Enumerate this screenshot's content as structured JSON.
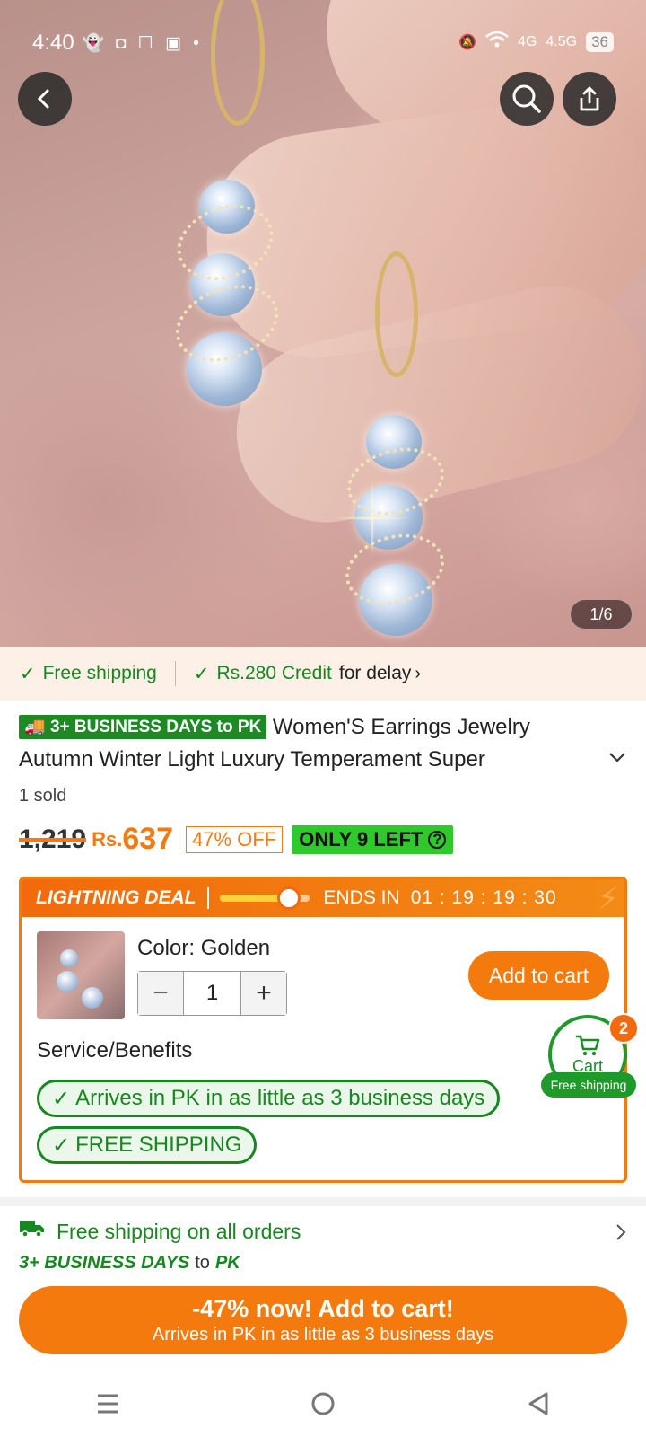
{
  "status_bar": {
    "time": "4:40",
    "battery": "36",
    "net1": "4G",
    "net2": "4.5G"
  },
  "gallery": {
    "counter": "1/6"
  },
  "shipping_strip": {
    "free_shipping": "Free shipping",
    "credit": "Rs.280 Credit",
    "credit_suffix": "for delay"
  },
  "product": {
    "days_badge": "3+ BUSINESS DAYS to PK",
    "title_line1": "Women'S Earrings Jewelry",
    "title_line2": "Autumn Winter Light Luxury Temperament Super",
    "sold": "1 sold"
  },
  "price": {
    "old": "1,219",
    "currency": "Rs.",
    "current": "637",
    "discount": "47% OFF",
    "stock": "ONLY 9 LEFT"
  },
  "deal": {
    "title": "LIGHTNING DEAL",
    "progress": 0.75,
    "ends_label": "ENDS IN",
    "countdown": "01 : 19 : 19 : 30"
  },
  "selection": {
    "color_label": "Color: Golden",
    "quantity": "1",
    "add_to_cart": "Add to cart"
  },
  "services": {
    "label": "Service/Benefits",
    "arrives": "Arrives in PK in as little as 3 business days",
    "free": "FREE SHIPPING"
  },
  "floating_cart": {
    "label": "Cart",
    "count": "2",
    "free_tag": "Free shipping"
  },
  "shipping_info": {
    "line": "Free shipping on all orders",
    "days": "3+ BUSINESS DAYS",
    "to": "to",
    "dest": "PK"
  },
  "cta": {
    "main": "-47% now! Add to cart!",
    "sub": "Arrives in PK in as little as 3 business days"
  },
  "colors": {
    "accent": "#f47a0e",
    "green": "#17871f",
    "stock_green": "#2ec92a"
  }
}
